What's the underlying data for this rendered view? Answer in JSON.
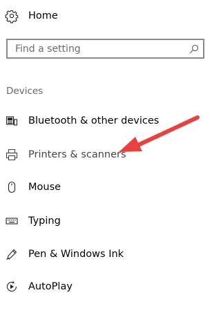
{
  "nav": {
    "home": {
      "label": "Home",
      "icon": "gear-icon"
    }
  },
  "search": {
    "placeholder": "Find a setting",
    "value": "",
    "icon": "search-icon"
  },
  "section": {
    "title": "Devices"
  },
  "menu": {
    "items": [
      {
        "label": "Bluetooth & other devices",
        "icon": "bluetooth-devices-icon"
      },
      {
        "label": "Printers & scanners",
        "icon": "printer-icon"
      },
      {
        "label": "Mouse",
        "icon": "mouse-icon"
      },
      {
        "label": "Typing",
        "icon": "keyboard-icon"
      },
      {
        "label": "Pen & Windows Ink",
        "icon": "pen-icon"
      },
      {
        "label": "AutoPlay",
        "icon": "autoplay-icon"
      }
    ]
  },
  "annotation": {
    "arrow_color": "#e8413f",
    "points_to": "Printers & scanners"
  }
}
